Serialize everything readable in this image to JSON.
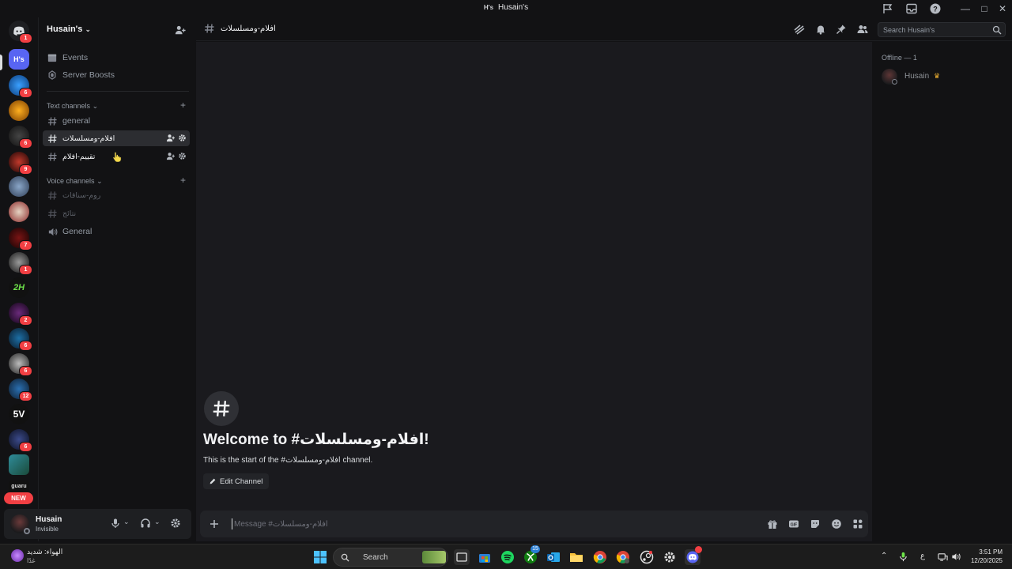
{
  "window": {
    "title": "Husain's",
    "logo_text": "H's"
  },
  "rail": {
    "selected_server": "H's",
    "new_badge": "NEW",
    "server_badges": [
      "1",
      "6",
      "",
      "6",
      "9",
      "",
      "",
      "7",
      "1",
      "",
      "2",
      "6",
      "6",
      "12",
      "",
      "6",
      ""
    ]
  },
  "sidebar": {
    "server_name": "Husain's",
    "top_items": [
      {
        "label": "Events",
        "icon": "calendar-icon"
      },
      {
        "label": "Server Boosts",
        "icon": "boost-icon"
      }
    ],
    "text_category": "Text channels",
    "text_channels": [
      {
        "label": "general"
      },
      {
        "label": "افلام-ومسلسلات"
      },
      {
        "label": "تقييم-افلام"
      }
    ],
    "voice_category": "Voice channels",
    "voice_channels": [
      {
        "label": "روم-سناقات"
      },
      {
        "label": "نتائج"
      },
      {
        "label": "General"
      }
    ]
  },
  "user": {
    "name": "Husain",
    "status": "Invisible"
  },
  "header": {
    "channel_name": "افلام-ومسلسلات",
    "search_placeholder": "Search Husain's"
  },
  "chat": {
    "welcome_title": "Welcome to #افلام-ومسلسلات!",
    "welcome_sub": "This is the start of the #افلام-ومسلسلات channel.",
    "edit_button": "Edit Channel",
    "composer_placeholder": "Message #افلام-ومسلسلات"
  },
  "members": {
    "section": "Offline — 1",
    "list": [
      {
        "name": "Husain",
        "owner": true
      }
    ]
  },
  "taskbar": {
    "weather_line1": "الهواء: شديد",
    "weather_line2": "غدًا",
    "search_label": "Search",
    "xbox_badge": "15",
    "time": "3:51 PM",
    "date": "12/20/2025",
    "lang": "ع"
  },
  "colors": {
    "accent": "#5865f2",
    "badge": "#f23f43",
    "new": "#f23f43"
  }
}
